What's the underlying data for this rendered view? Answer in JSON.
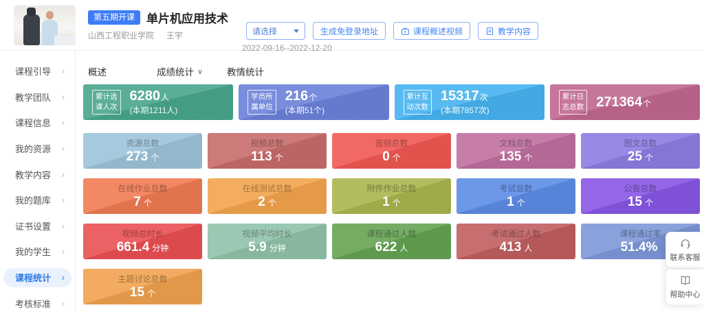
{
  "header": {
    "badge": "第五期开课",
    "title": "单片机应用技术",
    "school": "山西工程职业学院",
    "teacher": "王宇",
    "select_placeholder": "请选择",
    "date_range": "2022-09-16--2022-12-20",
    "buttons": {
      "generate_link": "生成免登录地址",
      "overview_video": "课程概述视频",
      "teaching_content": "教学内容"
    }
  },
  "sidebar": {
    "items": [
      {
        "label": "课程引导"
      },
      {
        "label": "教学团队"
      },
      {
        "label": "课程信息"
      },
      {
        "label": "我的资源"
      },
      {
        "label": "教学内容"
      },
      {
        "label": "我的题库"
      },
      {
        "label": "证书设置"
      },
      {
        "label": "我的学生"
      },
      {
        "label": "课程统计",
        "active": true
      },
      {
        "label": "考核标准"
      }
    ]
  },
  "tabs": {
    "overview": "概述",
    "grades": "成绩统计",
    "teaching": "教情统计"
  },
  "banners": [
    {
      "tag_line1": "累计选",
      "tag_line2": "课人次",
      "value": "6280",
      "unit": "人",
      "sub": "(本期1211人)",
      "color": "#47a58b"
    },
    {
      "tag_line1": "学员所",
      "tag_line2": "属单位",
      "value": "216",
      "unit": "个",
      "sub": "(本期51个)",
      "color": "#6a80d8"
    },
    {
      "tag_line1": "累计互",
      "tag_line2": "动次数",
      "value": "15317",
      "unit": "次",
      "sub": "(本期7857次)",
      "color": "#45b2ee"
    },
    {
      "tag_line1": "累计日",
      "tag_line2": "志总数",
      "value": "271364",
      "unit": "个",
      "sub": "",
      "color": "#c0668f"
    }
  ],
  "cards": [
    {
      "label": "资源总数",
      "value": "273",
      "unit": "个",
      "color": "#9cc3d9"
    },
    {
      "label": "视频总数",
      "value": "113",
      "unit": "个",
      "color": "#c76b6b"
    },
    {
      "label": "音频总数",
      "value": "0",
      "unit": "个",
      "color": "#f15853"
    },
    {
      "label": "文档总数",
      "value": "135",
      "unit": "个",
      "color": "#bf6f9f"
    },
    {
      "label": "图文总数",
      "value": "25",
      "unit": "个",
      "color": "#8b7de2"
    },
    {
      "label": "在线作业总数",
      "value": "7",
      "unit": "个",
      "color": "#f07b52"
    },
    {
      "label": "在线测试总数",
      "value": "2",
      "unit": "个",
      "color": "#f3a44c"
    },
    {
      "label": "附件作业总数",
      "value": "1",
      "unit": "个",
      "color": "#aab44d"
    },
    {
      "label": "考试总数",
      "value": "1",
      "unit": "个",
      "color": "#5c8ce6"
    },
    {
      "label": "公告总数",
      "value": "15",
      "unit": "个",
      "color": "#8756e4"
    },
    {
      "label": "视频总时长",
      "value": "661.4",
      "unit": "分钟",
      "color": "#ea4f52"
    },
    {
      "label": "视频平均时长",
      "value": "5.9",
      "unit": "分钟",
      "color": "#90c2a9"
    },
    {
      "label": "课程通过人数",
      "value": "622",
      "unit": "人",
      "color": "#64a352"
    },
    {
      "label": "考试通过人数",
      "value": "413",
      "unit": "人",
      "color": "#c05d60"
    },
    {
      "label": "课程通过率",
      "value": "51.4%",
      "unit": "",
      "color": "#7d97d8"
    },
    {
      "label": "主题讨论总数",
      "value": "15",
      "unit": "个",
      "color": "#f0a24e"
    }
  ],
  "floating": {
    "service": "联系客服",
    "help": "帮助中心"
  }
}
